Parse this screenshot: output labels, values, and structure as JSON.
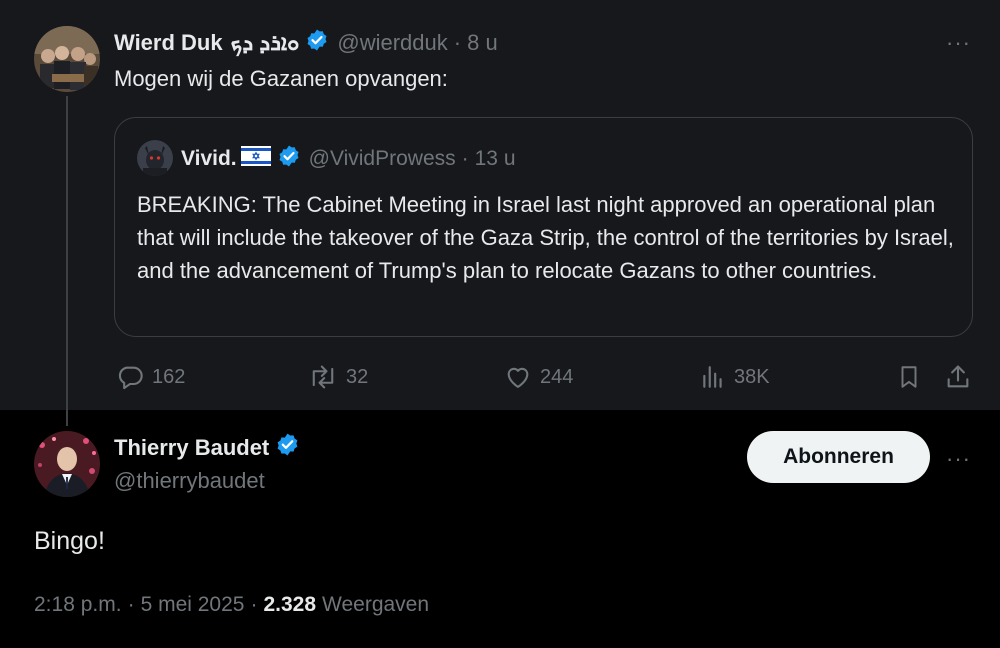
{
  "quoting_tweet": {
    "author_name": "Wierd Duk",
    "author_name_glyphs": "ܘܐܪܕ ܕܟ",
    "handle": "@wierdduk",
    "time": "8 u",
    "text": "Mogen wij de Gazanen opvangen:",
    "quoted": {
      "author_name": "Vivid.",
      "flag": "🇮🇱",
      "handle": "@VividProwess",
      "time": "13 u",
      "text": "BREAKING: The Cabinet Meeting in Israel last night approved an operational plan that will include the takeover of the Gaza Strip, the control of the territories by Israel, and the advancement of Trump's plan to relocate Gazans to other countries."
    },
    "actions": {
      "replies": "162",
      "reposts": "32",
      "likes": "244",
      "views": "38K"
    }
  },
  "main_tweet": {
    "author_name": "Thierry Baudet",
    "handle": "@thierrybaudet",
    "follow_label": "Abonneren",
    "text": "Bingo!",
    "time": "2:18 p.m.",
    "date": "5 mei 2025",
    "views_count": "2.328",
    "views_label": "Weergaven"
  },
  "icons": {
    "verified": "verified-badge-icon",
    "more": "more-options-icon",
    "reply": "reply-icon",
    "repost": "repost-icon",
    "like": "heart-icon",
    "views": "views-chart-icon",
    "bookmark": "bookmark-icon",
    "share": "share-icon"
  },
  "colors": {
    "verified": "#1d9bf0",
    "background": "#000000",
    "top_tweet_bg": "#16181c",
    "muted_text": "#71767b"
  }
}
